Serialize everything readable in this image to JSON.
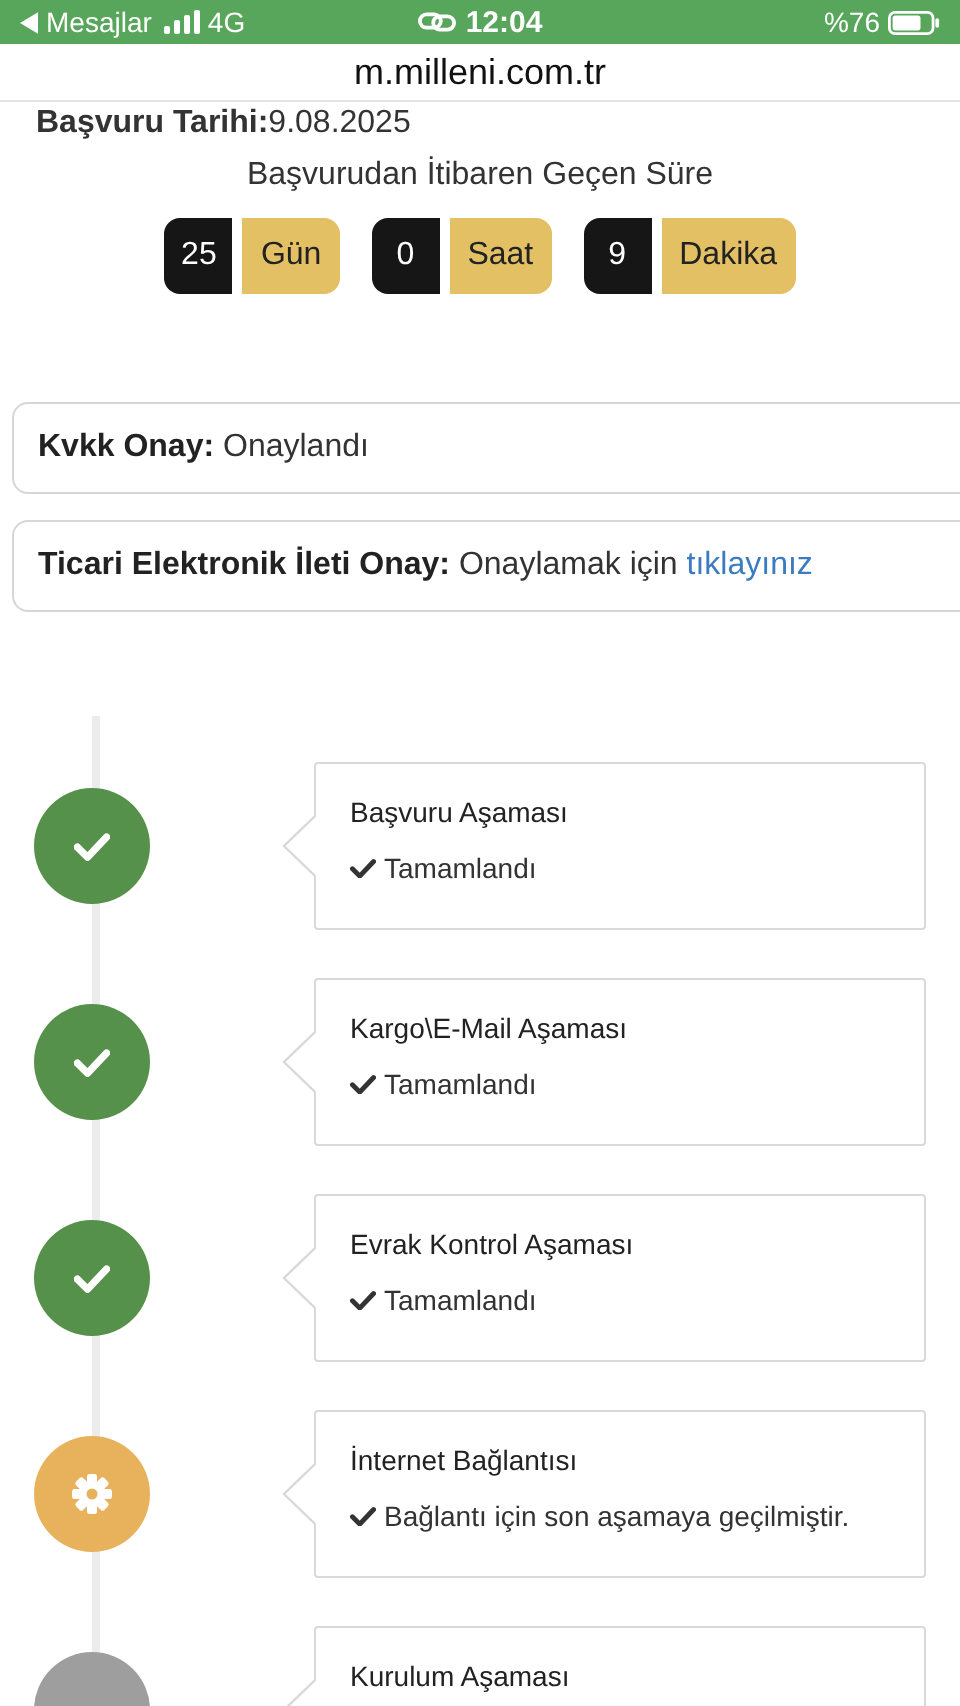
{
  "status_bar": {
    "back_label": "Mesajlar",
    "network": "4G",
    "time": "12:04",
    "battery": "%76"
  },
  "url_bar": {
    "url": "m.milleni.com.tr"
  },
  "application_date": {
    "label": "Başvuru Tarihi:",
    "value": "9.08.2025"
  },
  "elapsed": {
    "title": "Başvurudan İtibaren Geçen Süre",
    "units": [
      {
        "value": "25",
        "label": "Gün"
      },
      {
        "value": "0",
        "label": "Saat"
      },
      {
        "value": "9",
        "label": "Dakika"
      }
    ]
  },
  "approvals": [
    {
      "text": "**Kvkk Onay:** Onaylandı"
    },
    {
      "text": "**Ticari Elektronik İleti Onay:** Onaylamak için",
      "link": "tıklayınız"
    }
  ],
  "steps": [
    {
      "title": "Başvuru Aşaması",
      "kind": "done",
      "note": "Tamamlandı"
    },
    {
      "title": "Kargo\\E-Mail Aşaması",
      "kind": "done",
      "note": "Tamamlandı"
    },
    {
      "title": "Evrak Kontrol Aşaması",
      "kind": "done",
      "note": "Tamamlandı"
    },
    {
      "title": "İnternet Bağlantısı",
      "kind": "active",
      "note": "Bağlantı için son aşamaya geçilmiştir."
    },
    {
      "title": "Kurulum Aşaması",
      "kind": "pending"
    }
  ]
}
